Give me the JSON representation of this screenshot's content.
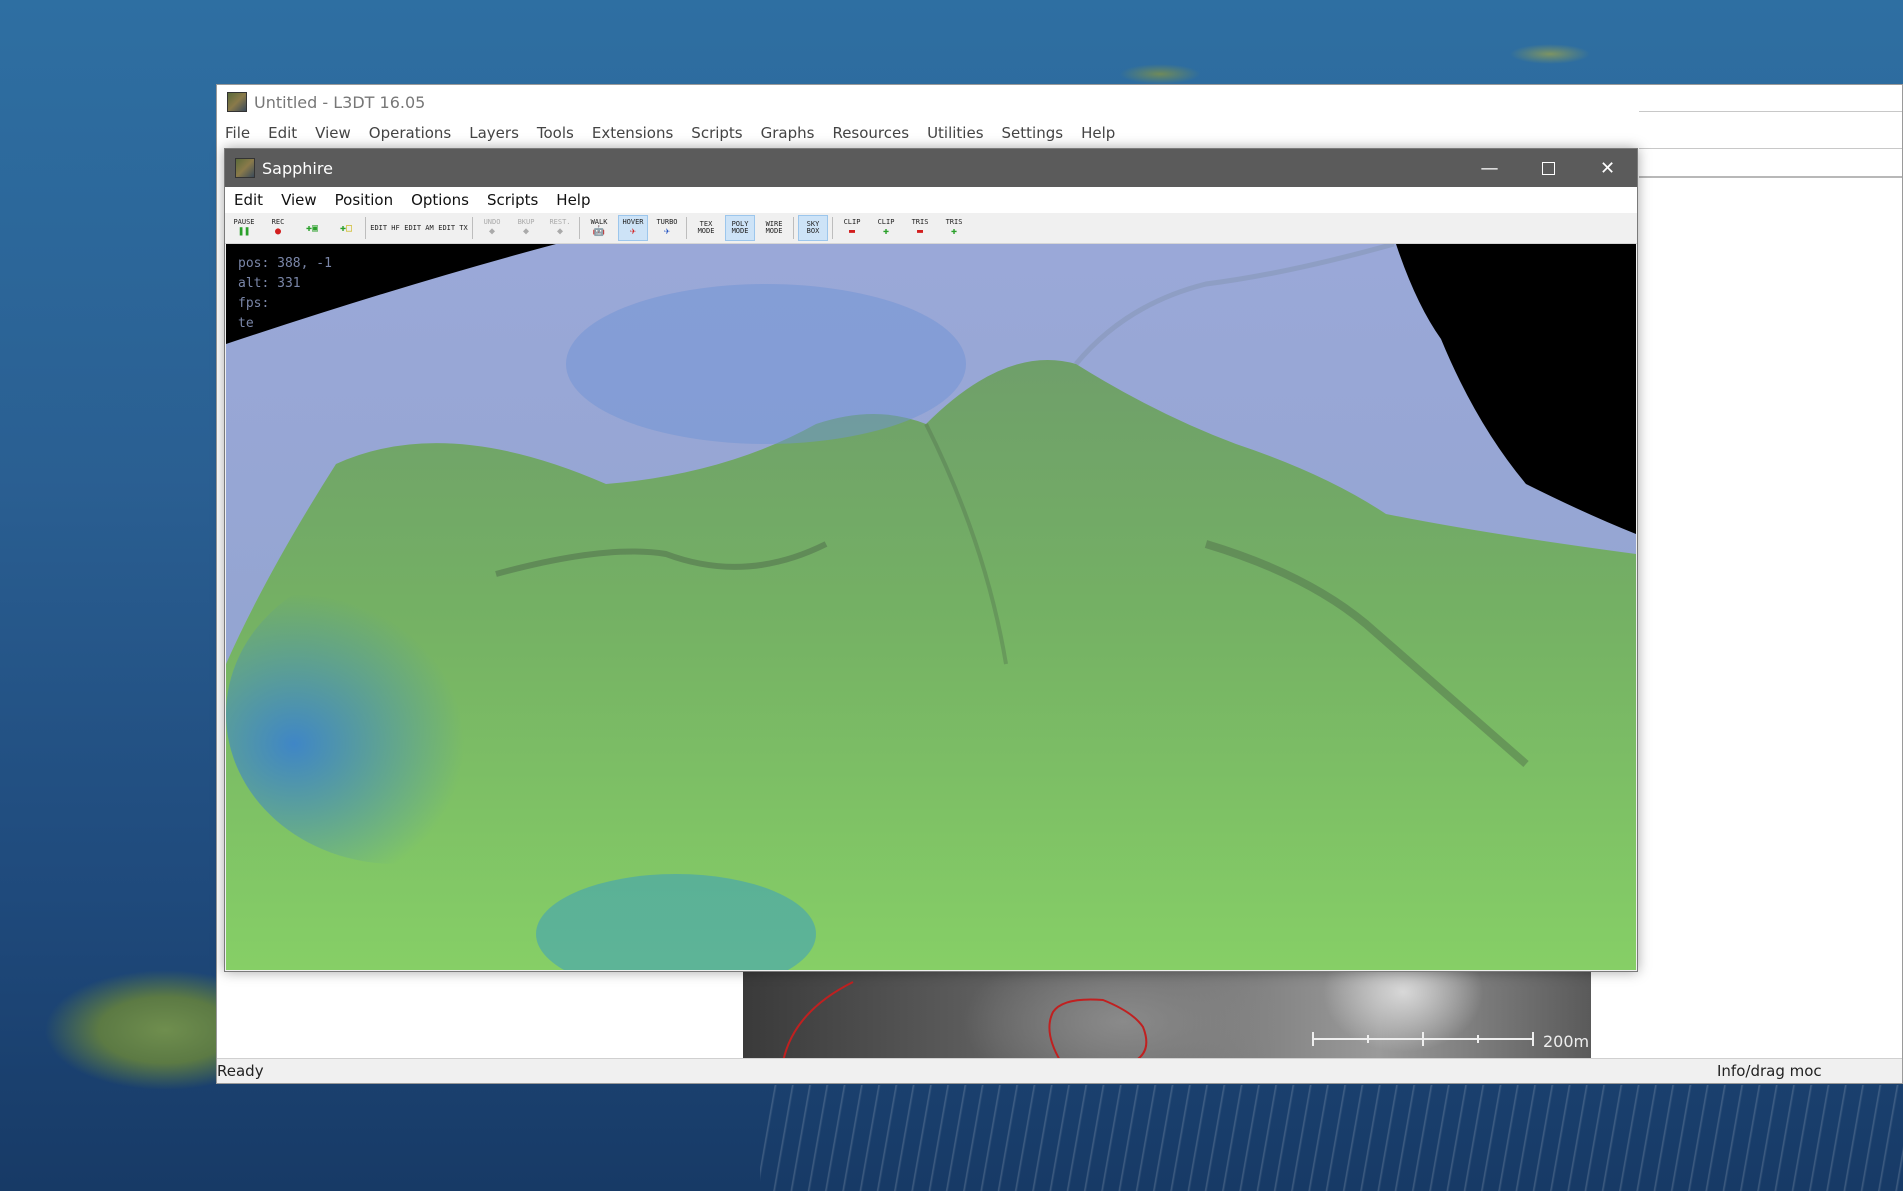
{
  "l3dt": {
    "title": "Untitled - L3DT 16.05",
    "menu": [
      "File",
      "Edit",
      "View",
      "Operations",
      "Layers",
      "Tools",
      "Extensions",
      "Scripts",
      "Graphs",
      "Resources",
      "Utilities",
      "Settings",
      "Help"
    ],
    "status_left": "Ready",
    "status_right": "Info/drag moc",
    "scale_label": "200m"
  },
  "sapphire": {
    "title": "Sapphire",
    "menu": [
      "Edit",
      "View",
      "Position",
      "Options",
      "Scripts",
      "Help"
    ],
    "toolbar": [
      {
        "label": "PAUSE",
        "icon": "pause-icon"
      },
      {
        "label": "REC",
        "icon": "record-icon"
      },
      {
        "label": "",
        "icon": "save-icon"
      },
      {
        "label": "",
        "icon": "load-icon"
      },
      {
        "label": "EDIT HF",
        "icon": "edit-heightfield-icon"
      },
      {
        "label": "EDIT AM",
        "icon": "edit-attributes-icon"
      },
      {
        "label": "EDIT TX",
        "icon": "edit-texture-icon"
      },
      {
        "label": "UNDO",
        "icon": "undo-icon"
      },
      {
        "label": "BKUP",
        "icon": "backup-icon"
      },
      {
        "label": "REST.",
        "icon": "restore-icon"
      },
      {
        "label": "WALK",
        "icon": "walk-icon"
      },
      {
        "label": "HOVER",
        "icon": "hover-icon"
      },
      {
        "label": "TURBO",
        "icon": "turbo-icon"
      },
      {
        "label": "TEX MODE",
        "icon": "texture-mode-icon"
      },
      {
        "label": "POLY MODE",
        "icon": "poly-mode-icon"
      },
      {
        "label": "WIRE MODE",
        "icon": "wire-mode-icon"
      },
      {
        "label": "SKY BOX",
        "icon": "skybox-icon"
      },
      {
        "label": "CLIP",
        "icon": "clip-minus-icon"
      },
      {
        "label": "CLIP",
        "icon": "clip-plus-icon"
      },
      {
        "label": "TRIS",
        "icon": "tris-minus-icon"
      },
      {
        "label": "TRIS",
        "icon": "tris-plus-icon"
      }
    ],
    "osd": {
      "pos": "pos: 388, -1",
      "alt": "alt: 331",
      "fps": "fps: ",
      "te": "te"
    }
  }
}
